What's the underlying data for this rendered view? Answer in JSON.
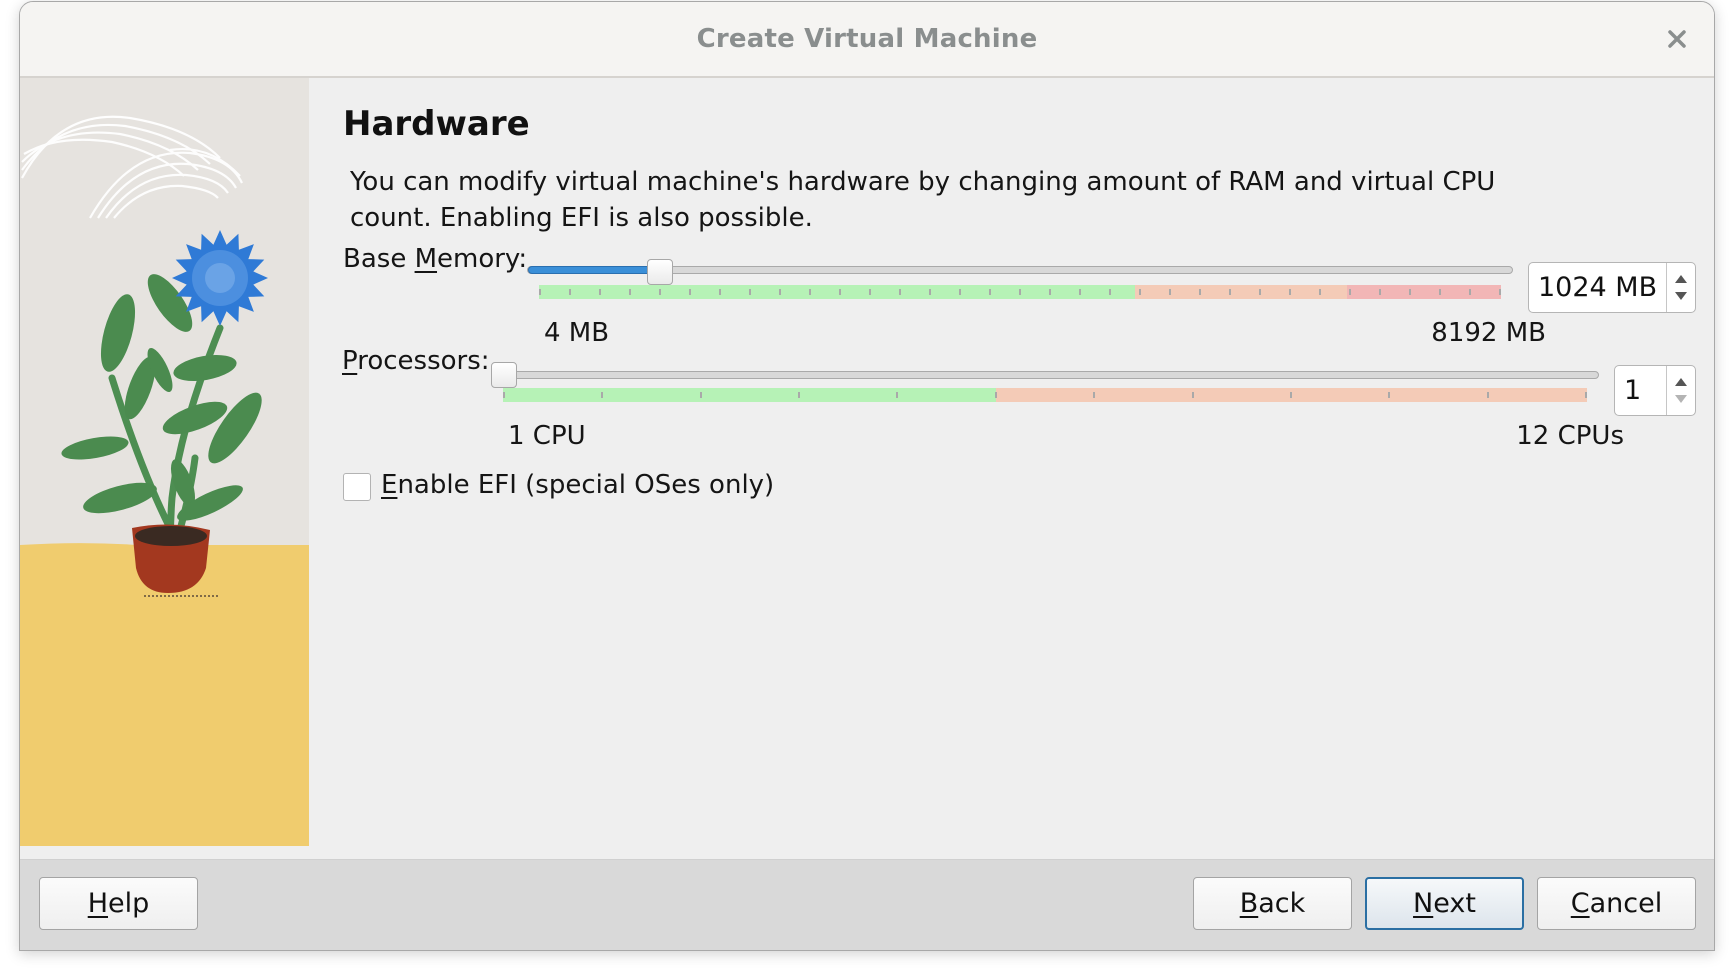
{
  "window": {
    "title": "Create Virtual Machine",
    "close_icon": "close-icon"
  },
  "page": {
    "heading": "Hardware",
    "description": "You can modify virtual machine's hardware by changing amount of RAM and virtual CPU count. Enabling EFI is also possible."
  },
  "memory": {
    "label_pre": "Base ",
    "label_mnemonic": "M",
    "label_post": "emory:",
    "min_label": "4 MB",
    "max_label": "8192 MB",
    "min": 4,
    "max": 8192,
    "value": 1024,
    "unit": "MB",
    "spin_value": "1024 MB",
    "zones": {
      "green_end_fraction": 0.62,
      "orange_end_fraction": 0.84
    },
    "tick_count": 33,
    "colors": {
      "green": "#b6f2b6",
      "orange": "#f4cbb7",
      "red": "#f2b6b6",
      "fill": "#3a8fd8"
    }
  },
  "processors": {
    "label_mnemonic": "P",
    "label_post": "rocessors:",
    "min_label": "1 CPU",
    "max_label": "12 CPUs",
    "min": 1,
    "max": 12,
    "value": 1,
    "spin_value": "1",
    "zones": {
      "green_end_fraction": 0.4545
    },
    "tick_count": 12,
    "colors": {
      "green": "#b6f2b6",
      "orange": "#f4cbb7"
    }
  },
  "efi": {
    "checked": false,
    "label_mnemonic": "E",
    "label_post": "nable EFI (special OSes only)"
  },
  "footer": {
    "help": {
      "mnemonic": "H",
      "rest": "elp"
    },
    "back": {
      "mnemonic": "B",
      "rest": "ack"
    },
    "next": {
      "mnemonic": "N",
      "rest": "ext"
    },
    "cancel": {
      "mnemonic": "C",
      "rest": "ancel"
    }
  },
  "sidebar": {
    "illustration": "potted-flower-illustration",
    "colors": {
      "sky": "#e6e3df",
      "table": "#f0cc6e",
      "flower": "#2f7ad6",
      "leaf": "#4b8b4f",
      "pot": "#a3381f"
    }
  }
}
